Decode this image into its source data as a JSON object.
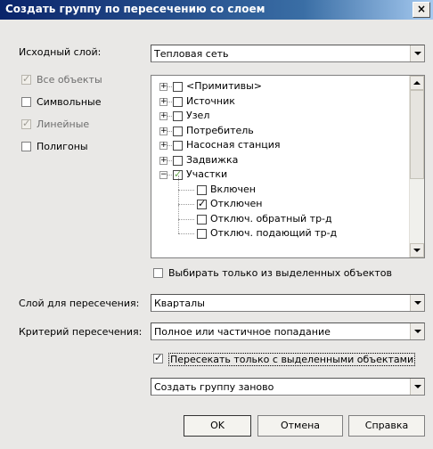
{
  "window": {
    "title": "Создать группу по пересечению со слоем",
    "close_glyph": "×"
  },
  "source_layer": {
    "label": "Исходный слой:",
    "value": "Тепловая сеть"
  },
  "filters": [
    {
      "label": "Все объекты",
      "checked": true,
      "disabled": true
    },
    {
      "label": "Символьные",
      "checked": false,
      "disabled": false
    },
    {
      "label": "Линейные",
      "checked": true,
      "disabled": true
    },
    {
      "label": "Полигоны",
      "checked": false,
      "disabled": false
    }
  ],
  "tree": {
    "items": [
      {
        "label": "<Примитивы>",
        "expander": "+",
        "checked": false,
        "level": 0
      },
      {
        "label": "Источник",
        "expander": "+",
        "checked": false,
        "level": 0
      },
      {
        "label": "Узел",
        "expander": "+",
        "checked": false,
        "level": 0
      },
      {
        "label": "Потребитель",
        "expander": "+",
        "checked": false,
        "level": 0
      },
      {
        "label": "Насосная станция",
        "expander": "+",
        "checked": false,
        "level": 0
      },
      {
        "label": "Задвижка",
        "expander": "+",
        "checked": false,
        "level": 0
      },
      {
        "label": "Участки",
        "expander": "−",
        "checked": true,
        "partial": true,
        "level": 0
      },
      {
        "label": "Включен",
        "checked": false,
        "level": 1
      },
      {
        "label": "Отключен",
        "checked": true,
        "level": 1
      },
      {
        "label": "Отключ. обратный тр-д",
        "checked": false,
        "level": 1
      },
      {
        "label": "Отключ. подающий тр-д",
        "checked": false,
        "level": 1
      }
    ]
  },
  "only_selected": {
    "label": "Выбирать только из выделенных объектов",
    "checked": false
  },
  "intersect_layer": {
    "label": "Слой для пересечения:",
    "value": "Кварталы"
  },
  "criterion": {
    "label": "Критерий пересечения:",
    "value": "Полное или частичное попадание"
  },
  "intersect_selected": {
    "label": "Пересекать только с выделенными объектами",
    "checked": true
  },
  "group_mode": {
    "value": "Создать группу заново"
  },
  "buttons": {
    "ok": "OK",
    "cancel": "Отмена",
    "help": "Справка"
  }
}
